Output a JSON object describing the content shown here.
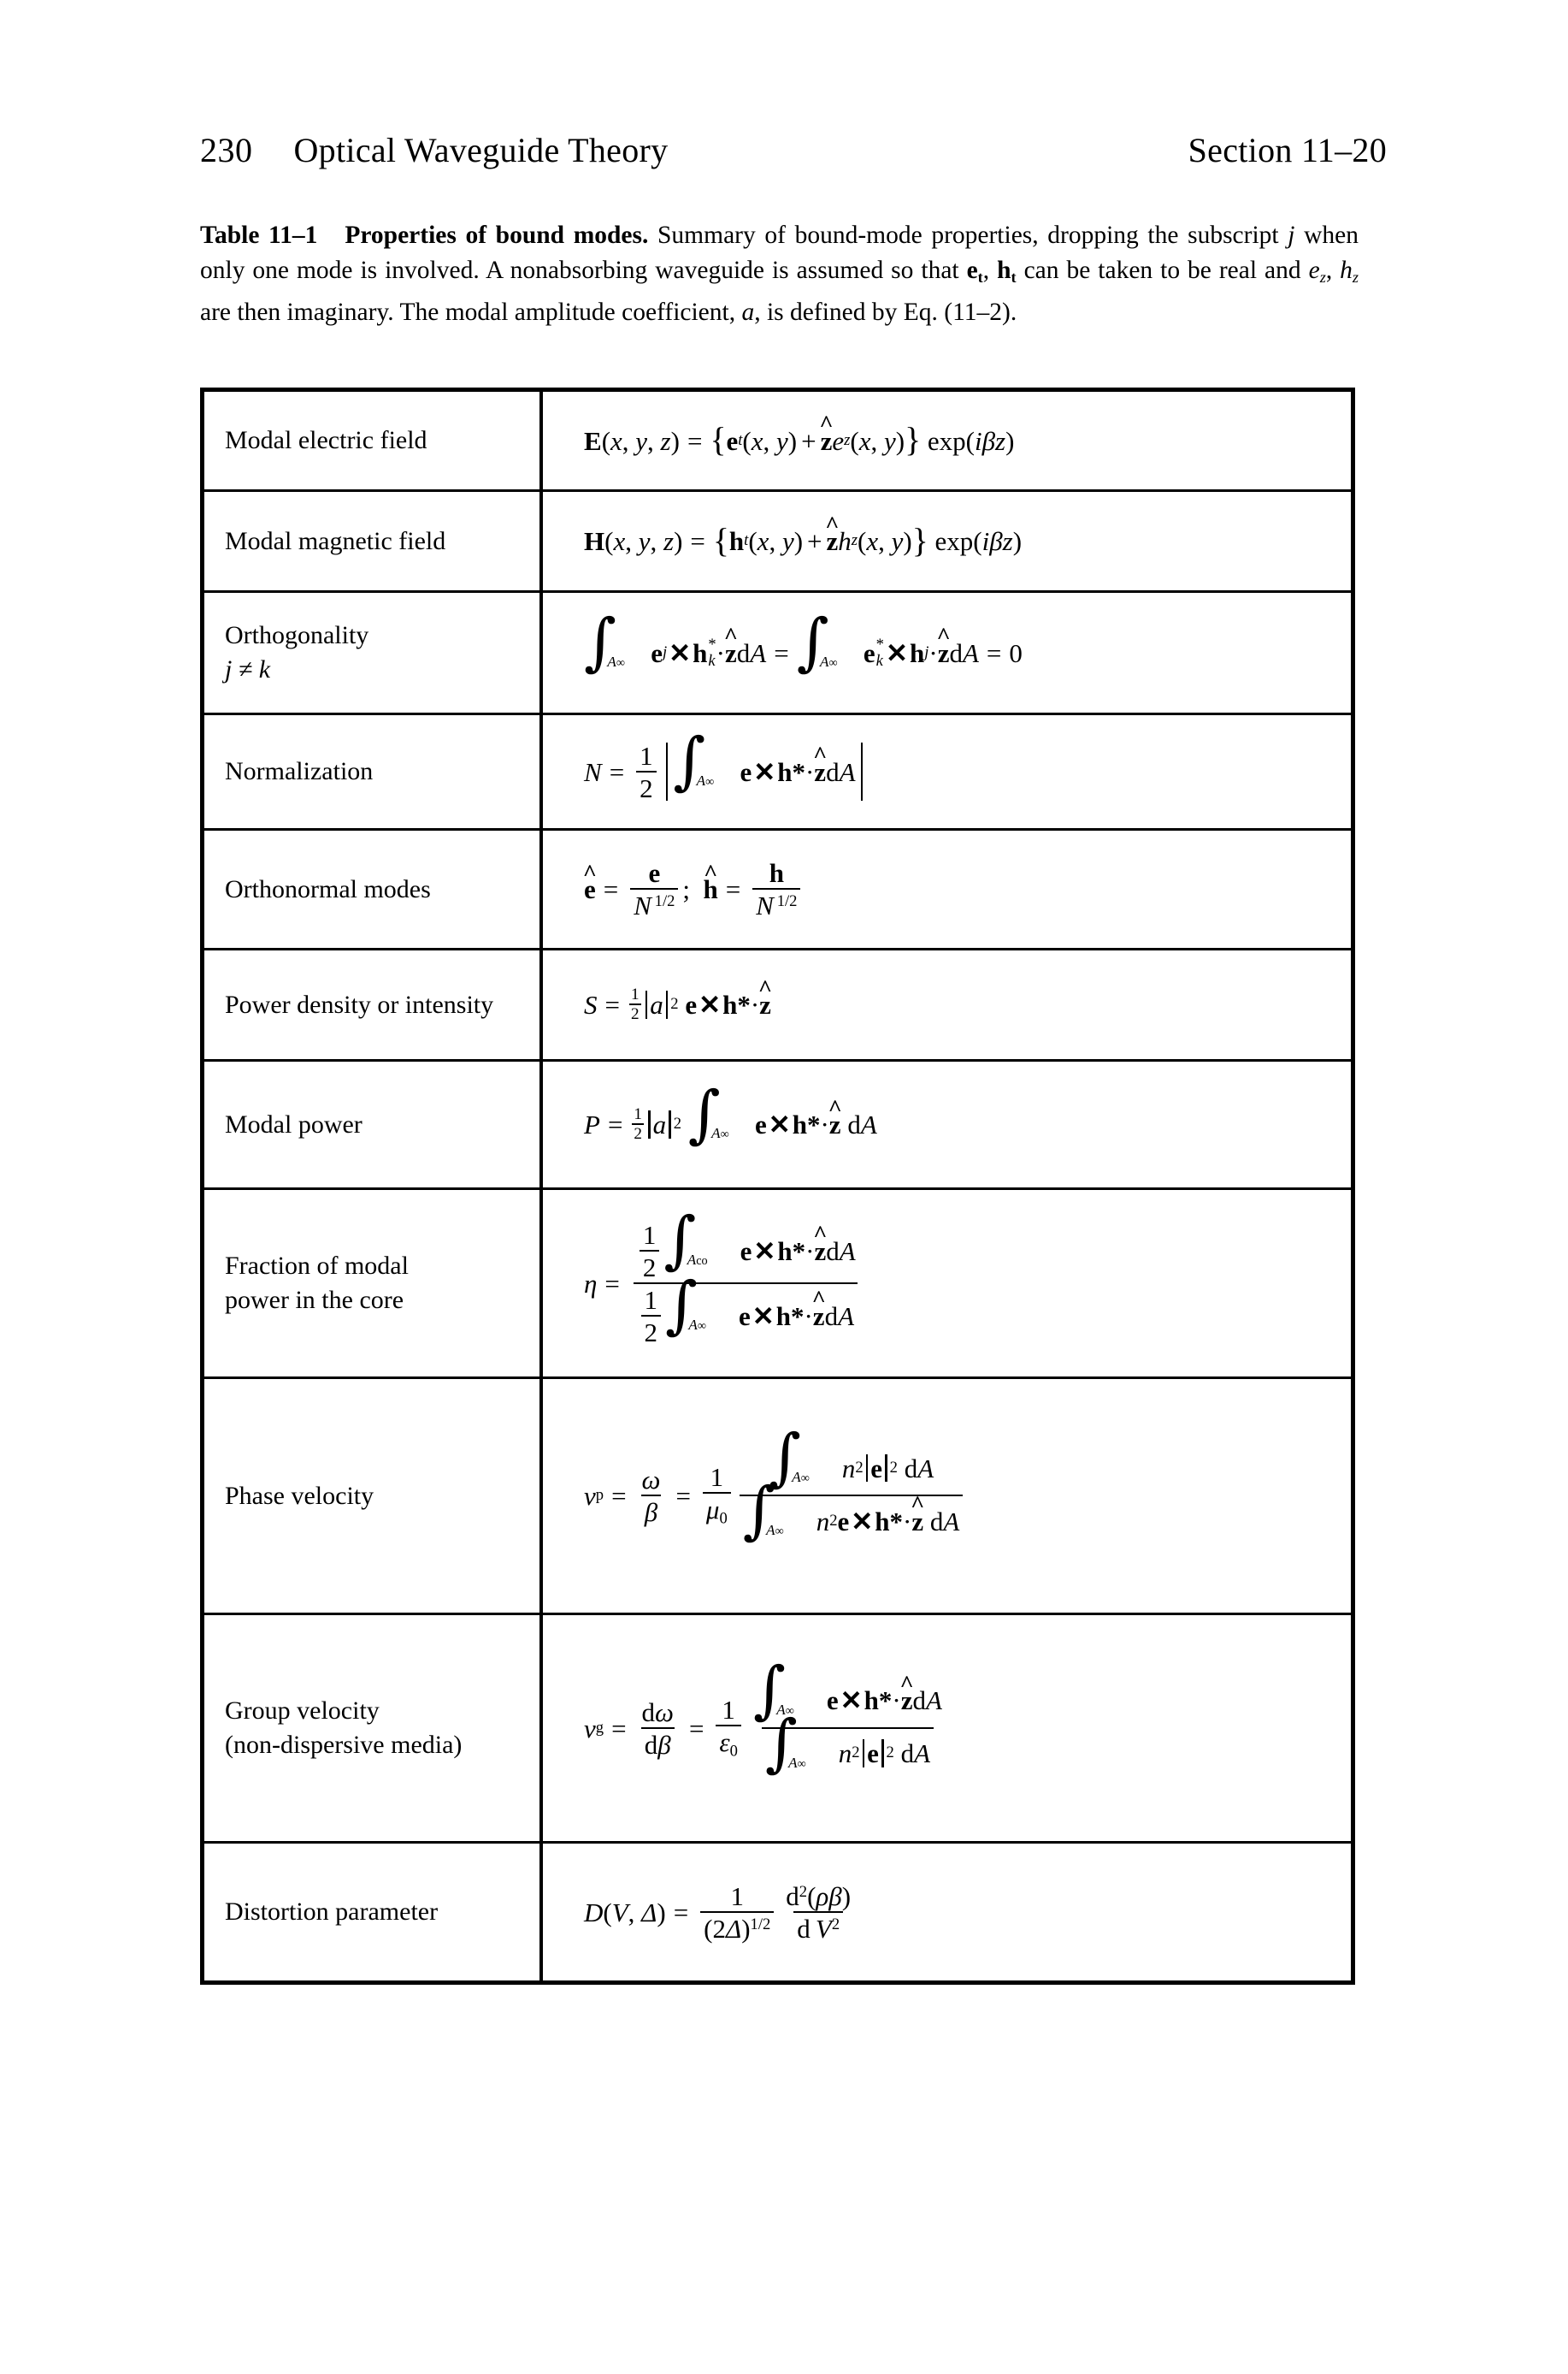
{
  "header": {
    "page_number": "230",
    "book_title": "Optical Waveguide Theory",
    "section_ref": "Section 11–20"
  },
  "caption": {
    "table_number": "Table 11–1",
    "table_title": "Properties of bound modes.",
    "text_part_1": "Summary of bound-mode properties, dropping the subscript",
    "italic_j": "j",
    "text_part_2": "when only one mode is involved. A nonabsorbing waveguide is assumed so that",
    "sym_et": "e",
    "sym_et_sub": "t",
    "comma_1": ",",
    "sym_ht": "h",
    "sym_ht_sub": "t",
    "text_part_3": "can be taken to be real and",
    "sym_ez": "e",
    "sym_ez_sub": "z",
    "comma_2": ",",
    "sym_hz": "h",
    "sym_hz_sub": "z",
    "text_part_4": "are then imaginary. The modal amplitude coefficient,",
    "italic_a": "a",
    "text_part_5": ", is defined by Eq. (11–2)."
  },
  "table": {
    "rows": [
      {
        "label": "Modal electric field",
        "label_line2": "",
        "formula_plain": "E(x, y, z) = { e_t(x, y) + ẑ e_z(x, y) } exp(iβz)"
      },
      {
        "label": "Modal magnetic field",
        "label_line2": "",
        "formula_plain": "H(x, y, z) = { h_t(x, y) + ẑ h_z(x, y) } exp(iβz)"
      },
      {
        "label": "Orthogonality",
        "label_line2": "j ≠ k",
        "formula_plain": "∫_{A∞} e_j × h*_k · ẑ dA = ∫_{A∞} e*_k × h_j · ẑ dA = 0"
      },
      {
        "label": "Normalization",
        "label_line2": "",
        "formula_plain": "N = (1/2) | ∫_{A∞} e × h* · ẑ dA |"
      },
      {
        "label": "Orthonormal modes",
        "label_line2": "",
        "formula_plain": "ê = e / N^{1/2} ;  ĥ = h / N^{1/2}"
      },
      {
        "label": "Power density or intensity",
        "label_line2": "",
        "formula_plain": "S = ½ |a|² e × h* · ẑ"
      },
      {
        "label": "Modal power",
        "label_line2": "",
        "formula_plain": "P = ½ |a|² ∫_{A∞} e × h* · ẑ dA"
      },
      {
        "label": "Fraction of modal",
        "label_line2": "power in the core",
        "formula_plain": "η = [ (1/2) ∫_{Aco} e × h* · ẑ dA ] / [ (1/2) ∫_{A∞} e × h* · ẑ dA ]"
      },
      {
        "label": "Phase velocity",
        "label_line2": "",
        "formula_plain": "v_p = ω/β = (1/μ₀) [ ∫_{A∞} n²|e|² dA ] / [ ∫_{A∞} n² e × h* · ẑ dA ]"
      },
      {
        "label": "Group velocity",
        "label_line2": "(non-dispersive media)",
        "formula_plain": "v_g = dω/dβ = (1/ε₀) [ ∫_{A∞} e × h* · ẑ dA ] / [ ∫_{A∞} n²|e|² dA ]"
      },
      {
        "label": "Distortion parameter",
        "label_line2": "",
        "formula_plain": "D(V, Δ) = [1 / (2Δ)^{1/2}] · d²(ρβ)/dV²"
      }
    ],
    "symbols": {
      "E": "E",
      "H": "H",
      "N": "N",
      "S": "S",
      "P": "P",
      "D": "D",
      "e": "e",
      "h": "h",
      "a": "a",
      "n": "n",
      "V": "V",
      "A": "A",
      "eta": "η",
      "omega": "ω",
      "beta": "β",
      "mu": "μ",
      "epsilon": "ε",
      "rho": "ρ",
      "Delta": "Δ",
      "infinity": "∞",
      "integral": "∫",
      "times": "×",
      "cdot": "·",
      "equals": "=",
      "neq": "≠",
      "zero": "0",
      "one": "1",
      "two": "2",
      "half": "1/2",
      "co": "co",
      "t": "t",
      "z": "z",
      "j": "j",
      "k": "k",
      "p": "p",
      "g": "g",
      "star": "*",
      "exp": "exp",
      "d": "d",
      "v": "v",
      "i": "i",
      "x": "x",
      "y": "y"
    }
  }
}
